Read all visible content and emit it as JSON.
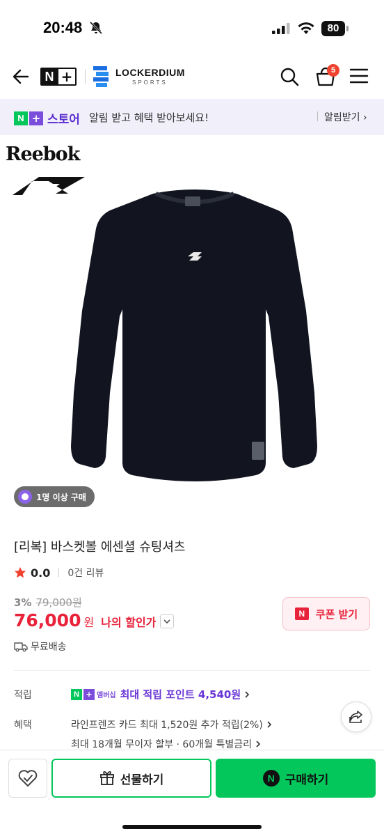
{
  "status_bar": {
    "time": "20:48",
    "battery": "80",
    "icons": [
      "bell-off-icon",
      "cellular-signal-icon",
      "wifi-icon",
      "battery-icon"
    ]
  },
  "header": {
    "nplus_n": "N",
    "nplus_plus": "+",
    "store_name": "LOCKERDIUM",
    "store_sub": "SPORTS",
    "cart_count": "5",
    "icons": [
      "back-arrow-icon",
      "search-icon",
      "cart-icon",
      "hamburger-menu-icon"
    ]
  },
  "notice": {
    "brand_n": "N",
    "brand_plus": "+",
    "store_label": "스토어",
    "text": "알림 받고 혜택 받아보세요!",
    "link": "알림받기"
  },
  "product": {
    "brand": "Reebok",
    "purchase_chip": "1명 이상 구매",
    "title": "[리복] 바스켓볼 에센셜 슈팅셔츠",
    "rating": "0.0",
    "review_count": "0건 리뷰",
    "discount_rate": "3%",
    "original_price": "79,000원",
    "price": "76,000",
    "price_unit": "원",
    "my_discount": "나의 할인가",
    "coupon_icon": "N",
    "coupon_label": "쿠폰 받기",
    "shipping": "무료배송"
  },
  "benefits": {
    "point_label": "적립",
    "membership_n": "N",
    "membership_plus": "+",
    "membership_text": "멤버십",
    "max_point": "최대 적립 포인트 4,540원",
    "benefit_label": "혜택",
    "line1": "라인프렌즈 카드 최대 1,520원 추가 적립(2%)",
    "line2": "최대 18개월 무이자 할부 · 60개월 특별금리"
  },
  "bottom_bar": {
    "gift_label": "선물하기",
    "buy_n": "N",
    "buy_label": "구매하기"
  },
  "colors": {
    "accent_green": "#03c75a",
    "accent_purple": "#7b4ddb",
    "price_red": "#e8223a"
  }
}
